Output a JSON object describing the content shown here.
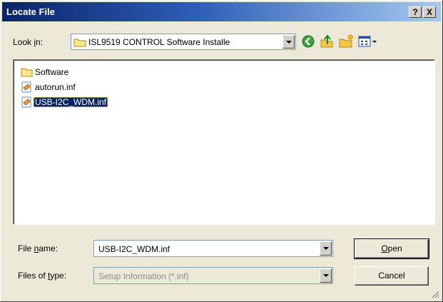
{
  "window": {
    "title": "Locate File",
    "help_label": "?",
    "close_label": "X"
  },
  "lookin": {
    "label_pre": "Look ",
    "label_u": "i",
    "label_post": "n:",
    "value": "ISL9519 CONTROL Software Installe"
  },
  "toolbar": {
    "icons": [
      "back-icon",
      "up-folder-icon",
      "new-folder-icon",
      "view-menu-icon"
    ]
  },
  "files": [
    {
      "name": "Software",
      "icon": "folder-icon",
      "selected": false
    },
    {
      "name": "autorun.inf",
      "icon": "setup-info-file-icon",
      "selected": false
    },
    {
      "name": "USB-I2C_WDM.inf",
      "icon": "setup-info-file-icon",
      "selected": true
    }
  ],
  "filename": {
    "label_pre": "File ",
    "label_u": "n",
    "label_post": "ame:",
    "value": "USB-I2C_WDM.inf"
  },
  "filetype": {
    "label_pre": "Files of ",
    "label_u": "t",
    "label_post": "ype:",
    "value": "Setup Information (*.inf)"
  },
  "buttons": {
    "open_u": "O",
    "open_rest": "pen",
    "cancel": "Cancel"
  },
  "colors": {
    "title_start": "#0a246a",
    "title_end": "#a6caf0",
    "selection": "#0a246a",
    "face": "#ece9d8"
  }
}
